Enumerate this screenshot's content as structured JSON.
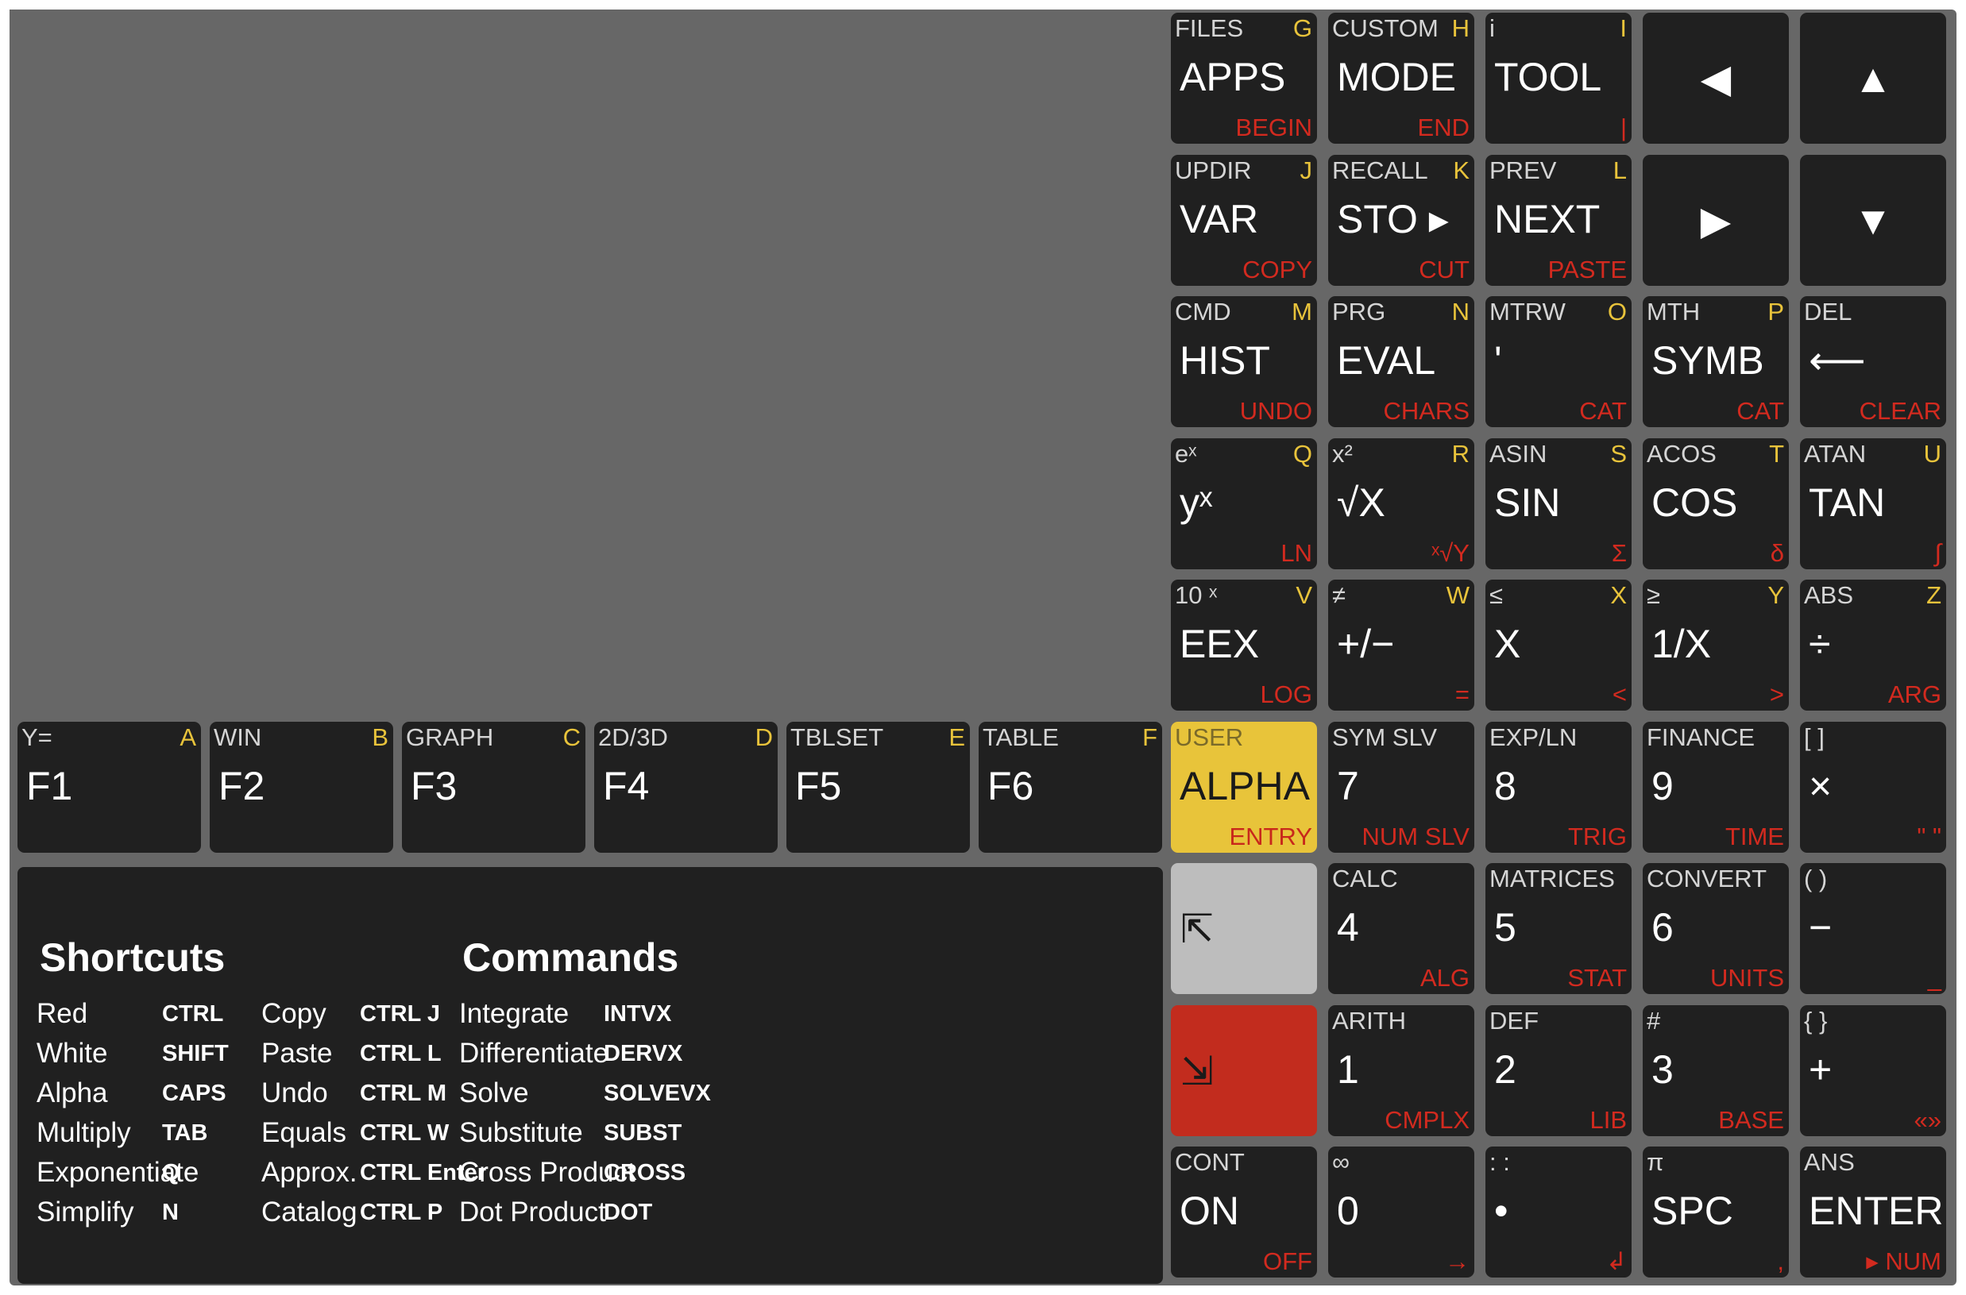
{
  "calculator_keys": [
    {
      "top": "FILES",
      "alpha": "G",
      "main": "APPS",
      "bottom": "BEGIN"
    },
    {
      "top": "CUSTOM",
      "alpha": "H",
      "main": "MODE",
      "bottom": "END"
    },
    {
      "top": "i",
      "alpha": "I",
      "main": "TOOL",
      "bottom": "|"
    },
    {
      "main": "◀"
    },
    {
      "main": "▲"
    },
    {
      "top": "UPDIR",
      "alpha": "J",
      "main": "VAR",
      "bottom": "COPY"
    },
    {
      "top": "RECALL",
      "alpha": "K",
      "main": "STO ▸",
      "bottom": "CUT"
    },
    {
      "top": "PREV",
      "alpha": "L",
      "main": "NEXT",
      "bottom": "PASTE"
    },
    {
      "main": "▶"
    },
    {
      "main": "▼"
    },
    {
      "top": "CMD",
      "alpha": "M",
      "main": "HIST",
      "bottom": "UNDO"
    },
    {
      "top": "PRG",
      "alpha": "N",
      "main": "EVAL",
      "bottom": "CHARS"
    },
    {
      "top": "MTRW",
      "alpha": "O",
      "main": "'",
      "bottom": "CAT"
    },
    {
      "top": "MTH",
      "alpha": "P",
      "main": "SYMB",
      "bottom": "CAT"
    },
    {
      "top": "DEL",
      "alpha": "",
      "main": "⟵",
      "bottom": "CLEAR"
    },
    {
      "top": "eˣ",
      "alpha": "Q",
      "main": "yˣ",
      "bottom": "LN"
    },
    {
      "top": "x²",
      "alpha": "R",
      "main": "√X",
      "bottom": "ˣ√Y"
    },
    {
      "top": "ASIN",
      "alpha": "S",
      "main": "SIN",
      "bottom": "Σ"
    },
    {
      "top": "ACOS",
      "alpha": "T",
      "main": "COS",
      "bottom": "δ"
    },
    {
      "top": "ATAN",
      "alpha": "U",
      "main": "TAN",
      "bottom": "∫"
    },
    {
      "top": "10 ˣ",
      "alpha": "V",
      "main": "EEX",
      "bottom": "LOG"
    },
    {
      "top": "≠",
      "alpha": "W",
      "main": "+/−",
      "bottom": "="
    },
    {
      "top": "≤",
      "alpha": "X",
      "main": "X",
      "bottom": "<"
    },
    {
      "top": "≥",
      "alpha": "Y",
      "main": "1/X",
      "bottom": ">"
    },
    {
      "top": "ABS",
      "alpha": "Z",
      "main": "÷",
      "bottom": "ARG"
    },
    {
      "top": "Y=",
      "alpha": "A",
      "main": "F1",
      "bottom": ""
    },
    {
      "top": "WIN",
      "alpha": "B",
      "main": "F2",
      "bottom": ""
    },
    {
      "top": "GRAPH",
      "alpha": "C",
      "main": "F3",
      "bottom": ""
    },
    {
      "top": "2D/3D",
      "alpha": "D",
      "main": "F4",
      "bottom": ""
    },
    {
      "top": "TBLSET",
      "alpha": "E",
      "main": "F5",
      "bottom": ""
    },
    {
      "top": "TABLE",
      "alpha": "F",
      "main": "F6",
      "bottom": ""
    },
    {
      "top": "USER",
      "alpha": "",
      "main": "ALPHA",
      "bottom": "ENTRY"
    },
    {
      "top": "SYM SLV",
      "alpha": "",
      "main": "7",
      "bottom": "NUM SLV"
    },
    {
      "top": "EXP/LN",
      "alpha": "",
      "main": "8",
      "bottom": "TRIG"
    },
    {
      "top": "FINANCE",
      "alpha": "",
      "main": "9",
      "bottom": "TIME"
    },
    {
      "top": "[ ]",
      "alpha": "",
      "main": "×",
      "bottom": "\" \""
    },
    {
      "main": "⇱"
    },
    {
      "top": "CALC",
      "alpha": "",
      "main": "4",
      "bottom": "ALG"
    },
    {
      "top": "MATRICES",
      "alpha": "",
      "main": "5",
      "bottom": "STAT"
    },
    {
      "top": "CONVERT",
      "alpha": "",
      "main": "6",
      "bottom": "UNITS"
    },
    {
      "top": "( )",
      "alpha": "",
      "main": "−",
      "bottom": "_"
    },
    {
      "main": "⇲"
    },
    {
      "top": "ARITH",
      "alpha": "",
      "main": "1",
      "bottom": "CMPLX"
    },
    {
      "top": "DEF",
      "alpha": "",
      "main": "2",
      "bottom": "LIB"
    },
    {
      "top": "#",
      "alpha": "",
      "main": "3",
      "bottom": "BASE"
    },
    {
      "top": "{ }",
      "alpha": "",
      "main": "+",
      "bottom": "«»"
    },
    {
      "top": "CONT",
      "alpha": "",
      "main": "ON",
      "bottom": "OFF"
    },
    {
      "top": "∞",
      "alpha": "",
      "main": "0",
      "bottom": "→"
    },
    {
      "top": ": :",
      "alpha": "",
      "main": "•",
      "bottom": "↲"
    },
    {
      "top": "π",
      "alpha": "",
      "main": "SPC",
      "bottom": ","
    },
    {
      "top": "ANS",
      "alpha": "",
      "main": "ENTER",
      "bottom": "▸ NUM"
    }
  ],
  "shortcuts": {
    "title": "Shortcuts",
    "col1": [
      "Red",
      "White",
      "Alpha",
      "Multiply",
      "Exponentiate",
      "Simplify"
    ],
    "col2": [
      "CTRL",
      "SHIFT",
      "CAPS",
      "TAB",
      "Q",
      "N"
    ],
    "col3": [
      "Copy",
      "Paste",
      "Undo",
      "Equals",
      "Approx.",
      "Catalog"
    ],
    "col4": [
      "CTRL J",
      "CTRL L",
      "CTRL M",
      "CTRL W",
      "CTRL Enter",
      "CTRL P"
    ]
  },
  "commands": {
    "title": "Commands",
    "col1": [
      "Integrate",
      "Differentiate",
      "Solve",
      "Substitute",
      "Cross Product",
      "Dot Product"
    ],
    "col2": [
      "INTVX",
      "DERVX",
      "SOLVEVX",
      "SUBST",
      "CROSS",
      "DOT"
    ]
  },
  "colors": {
    "background": "#676767",
    "key": "#202020",
    "alpha_letter": "#e8c33b",
    "shift_red": "#d22a1f",
    "alpha_key": "#e8c43a",
    "left_shift_key": "#bdbdbd",
    "right_shift_key": "#c22c1e"
  }
}
